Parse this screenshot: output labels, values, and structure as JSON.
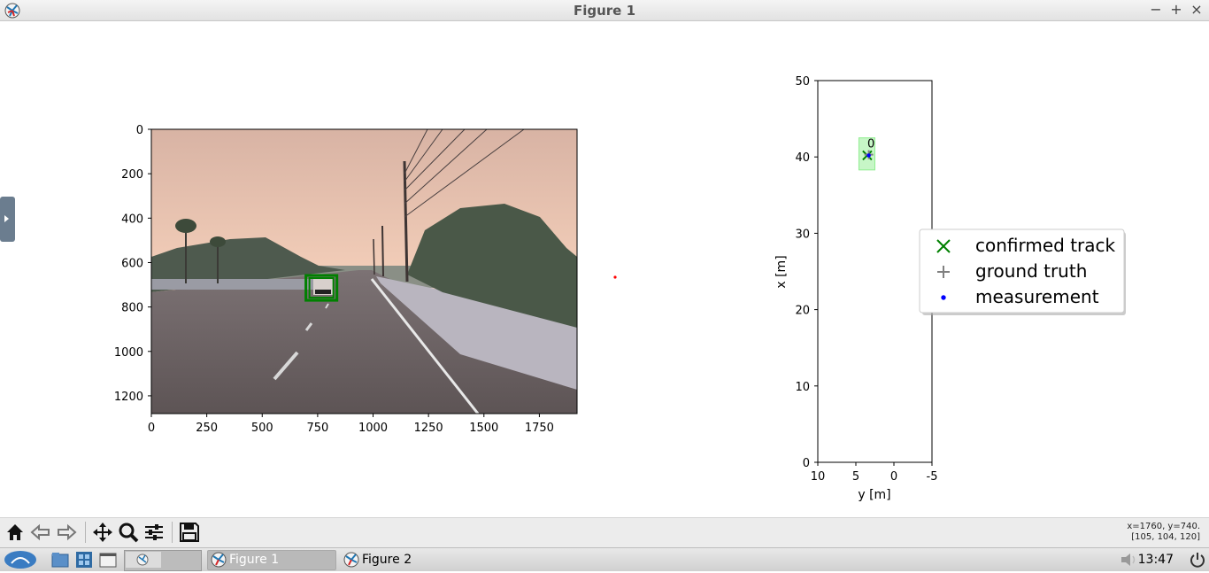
{
  "window": {
    "title": "Figure 1",
    "minimize": "−",
    "maximize": "+",
    "close": "×"
  },
  "camera_plot": {
    "x_ticks": [
      "0",
      "250",
      "500",
      "750",
      "1000",
      "1250",
      "1500",
      "1750"
    ],
    "y_ticks": [
      "0",
      "200",
      "400",
      "600",
      "800",
      "1000",
      "1200"
    ],
    "x_range": [
      0,
      1920
    ],
    "y_range": [
      1280,
      0
    ],
    "detection_box": {
      "x_min": 697,
      "x_max": 837,
      "y_min": 658,
      "y_max": 770,
      "color": "#008000"
    }
  },
  "chart_data": {
    "type": "scatter",
    "xlabel": "y [m]",
    "ylabel": "x [m]",
    "xlim": [
      10,
      -5
    ],
    "ylim": [
      0,
      50
    ],
    "x_ticks": [
      "10",
      "5",
      "0",
      "-5"
    ],
    "y_ticks": [
      "0",
      "10",
      "20",
      "30",
      "40",
      "50"
    ],
    "series": [
      {
        "name": "confirmed track",
        "marker": "x",
        "color": "#008000",
        "points": [
          [
            3.5,
            40.2
          ]
        ]
      },
      {
        "name": "ground truth",
        "marker": "+",
        "color": "#808080",
        "points": [
          [
            3.3,
            40.3
          ]
        ]
      },
      {
        "name": "measurement",
        "marker": "dot",
        "color": "#0000ff",
        "points": [
          [
            3.3,
            40.2
          ]
        ]
      }
    ],
    "track_box": {
      "y_min": 2.5,
      "y_max": 4.6,
      "x_min": 38.3,
      "x_max": 42.5,
      "color": "#90ee90"
    },
    "annotation": {
      "text": "0",
      "y": 3.0,
      "x": 41.8
    },
    "legend_location": "center-right",
    "grid": false
  },
  "red_marker": {
    "color": "#ff0000"
  },
  "toolbar": {
    "buttons": [
      "home-icon",
      "back-icon",
      "forward-icon",
      "pan-icon",
      "zoom-icon",
      "configure-subplots-icon",
      "save-icon"
    ],
    "coords_line1": "x=1760, y=740.",
    "coords_line2": "[105, 104, 120]"
  },
  "taskbar": {
    "tasks": [
      {
        "label": "Figure 1",
        "active": true
      },
      {
        "label": "Figure 2",
        "active": false
      }
    ],
    "clock": "13:47"
  }
}
